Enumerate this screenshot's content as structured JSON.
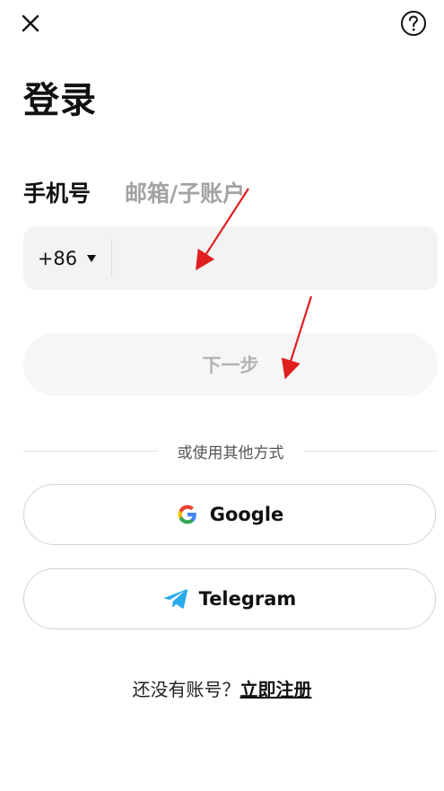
{
  "header": {
    "close_icon": "close-icon",
    "help_icon": "help-icon"
  },
  "login": {
    "title": "登录",
    "tabs": {
      "phone": "手机号",
      "email": "邮箱/子账户"
    },
    "country_code": "+86",
    "phone_value": "",
    "next_label": "下一步",
    "divider_text": "或使用其他方式",
    "google_label": "Google",
    "telegram_label": "Telegram",
    "no_account_text": "还没有账号？",
    "register_label": "立即注册"
  },
  "annotations": {
    "arrow_color": "#e02020"
  }
}
